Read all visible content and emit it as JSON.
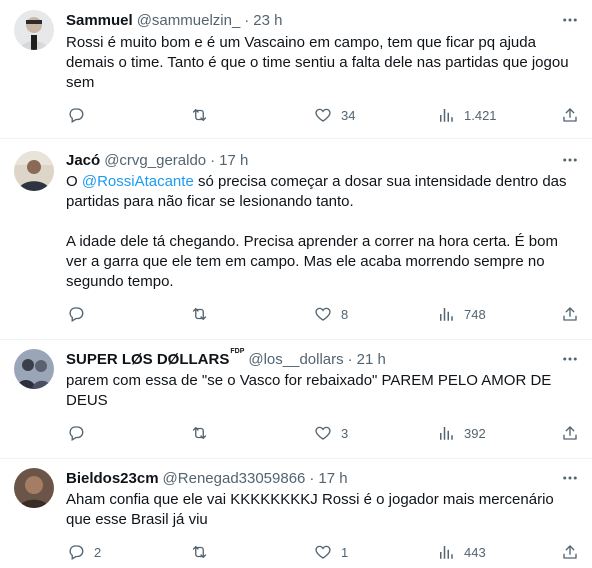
{
  "tweets": [
    {
      "name": "Sammuel",
      "handle": "@sammuelzin_",
      "separator": "·",
      "time": "23 h",
      "text": [
        "Rossi é muito bom e é um Vascaino em campo, tem que ficar pq ajuda demais o time. Tanto é que o time sentiu a falta dele nas partidas que jogou sem"
      ],
      "replies": "",
      "retweets": "",
      "likes": "34",
      "views": "1.421"
    },
    {
      "name": "Jacó",
      "handle": "@crvg_geraldo",
      "separator": "·",
      "time": "17 h",
      "mention_prefix": "O ",
      "mention": "@RossiAtacante",
      "text_after_mention": " só precisa começar a dosar sua intensidade dentro das partidas para não ficar se lesionando tanto.",
      "text2": "A idade dele tá chegando. Precisa aprender a correr na hora certa. É bom ver a garra que ele tem em campo. Mas ele acaba morrendo sempre no segundo tempo.",
      "replies": "",
      "retweets": "",
      "likes": "8",
      "views": "748"
    },
    {
      "name": "SUPER LØS DØLLARS",
      "name_sup": "FDP",
      "handle": "@los__dollars",
      "separator": "·",
      "time": "21 h",
      "text": [
        "parem com essa de \"se o Vasco for rebaixado\" PAREM PELO AMOR DE DEUS"
      ],
      "replies": "",
      "retweets": "",
      "likes": "3",
      "views": "392"
    },
    {
      "name": "Bieldos23cm",
      "handle": "@Renegad33059866",
      "separator": "·",
      "time": "17 h",
      "text": [
        "Aham confia que ele vai KKKKKKKKJ Rossi é o jogador mais mercenário que esse Brasil já viu"
      ],
      "replies": "2",
      "retweets": "",
      "likes": "1",
      "views": "443"
    }
  ],
  "colors": {
    "text": "#0f1419",
    "secondary": "#536471",
    "link": "#1d9bf0",
    "divider": "#eff3f4"
  }
}
